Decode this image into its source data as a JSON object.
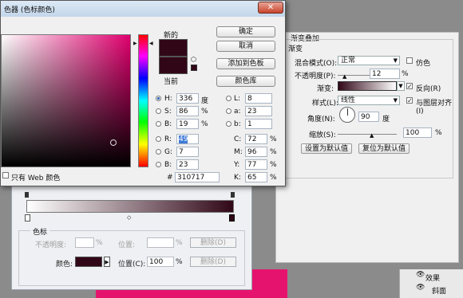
{
  "picker": {
    "title": "色器 (色标颜色)",
    "new_label": "新的",
    "current_label": "当前",
    "new_color": "#310717",
    "ok": "确定",
    "cancel": "取消",
    "add_swatch": "添加到色板",
    "color_library": "颜色库",
    "web_only": "只有 Web 颜色",
    "hsb": [
      {
        "label": "H:",
        "value": "336",
        "unit": "度"
      },
      {
        "label": "S:",
        "value": "86",
        "unit": "%"
      },
      {
        "label": "B:",
        "value": "19",
        "unit": "%"
      }
    ],
    "rgb": [
      {
        "label": "R:",
        "value": "49"
      },
      {
        "label": "G:",
        "value": "7"
      },
      {
        "label": "B:",
        "value": "23"
      }
    ],
    "lab": [
      {
        "label": "L:",
        "value": "8"
      },
      {
        "label": "a:",
        "value": "23"
      },
      {
        "label": "b:",
        "value": "1"
      }
    ],
    "cmyk": [
      {
        "label": "C:",
        "value": "72",
        "unit": "%"
      },
      {
        "label": "M:",
        "value": "96",
        "unit": "%"
      },
      {
        "label": "Y:",
        "value": "77",
        "unit": "%"
      },
      {
        "label": "K:",
        "value": "65",
        "unit": "%"
      }
    ],
    "hex_label": "#",
    "hex_value": "310717"
  },
  "style": {
    "section": "渐变叠加",
    "group": "渐变",
    "blend_label": "混合模式(O):",
    "blend_value": "正常",
    "dither_label": "仿色",
    "opacity_label": "不透明度(P):",
    "opacity_value": "12",
    "pct": "%",
    "gradient_label": "渐变:",
    "reverse_label": "反向(R)",
    "style_label": "样式(L):",
    "style_value": "线性",
    "align_label": "与图层对齐(I)",
    "angle_label": "角度(N):",
    "angle_value": "90",
    "angle_unit": "度",
    "scale_label": "缩放(S):",
    "scale_value": "100",
    "default_btn": "设置为默认值",
    "reset_btn": "复位为默认值"
  },
  "gradient_editor": {
    "group": "色标",
    "opacity_label": "不透明度:",
    "location_label": "位置:",
    "delete_label": "删除(D)",
    "color_label": "颜色:",
    "color_value": "#310717",
    "location2_label": "位置(C):",
    "location2_value": "100",
    "pct": "%"
  },
  "layers": {
    "effects": "效果",
    "item": "斜面"
  },
  "colors": {
    "accent_pink": "#e6136e"
  }
}
